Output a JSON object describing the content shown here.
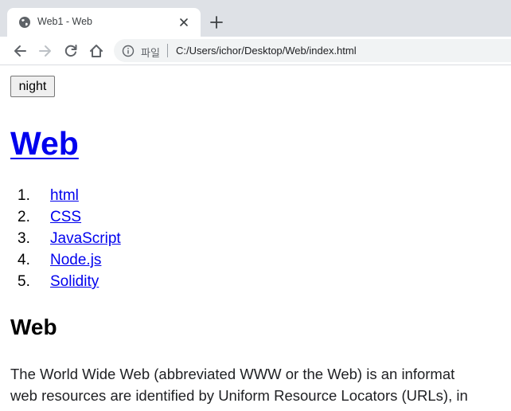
{
  "browser": {
    "tab": {
      "title": "Web1 - Web"
    },
    "toolbar": {
      "scheme_label": "파일",
      "url": "C:/Users/ichor/Desktop/Web/index.html"
    }
  },
  "page": {
    "night_button": "night",
    "heading": "Web",
    "toc": [
      {
        "num": "1.",
        "label": "html"
      },
      {
        "num": "2.",
        "label": "CSS"
      },
      {
        "num": "3.",
        "label": "JavaScript"
      },
      {
        "num": "4.",
        "label": "Node.js"
      },
      {
        "num": "5.",
        "label": "Solidity"
      }
    ],
    "subheading": "Web",
    "paragraph_lines": [
      "The World Wide Web (abbreviated WWW or the Web) is an informat",
      "web resources are identified by Uniform Resource Locators (URLs), in"
    ]
  },
  "colors": {
    "link": "#0000ee",
    "tabstrip": "#dee1e6",
    "omnibox": "#f1f3f4"
  }
}
